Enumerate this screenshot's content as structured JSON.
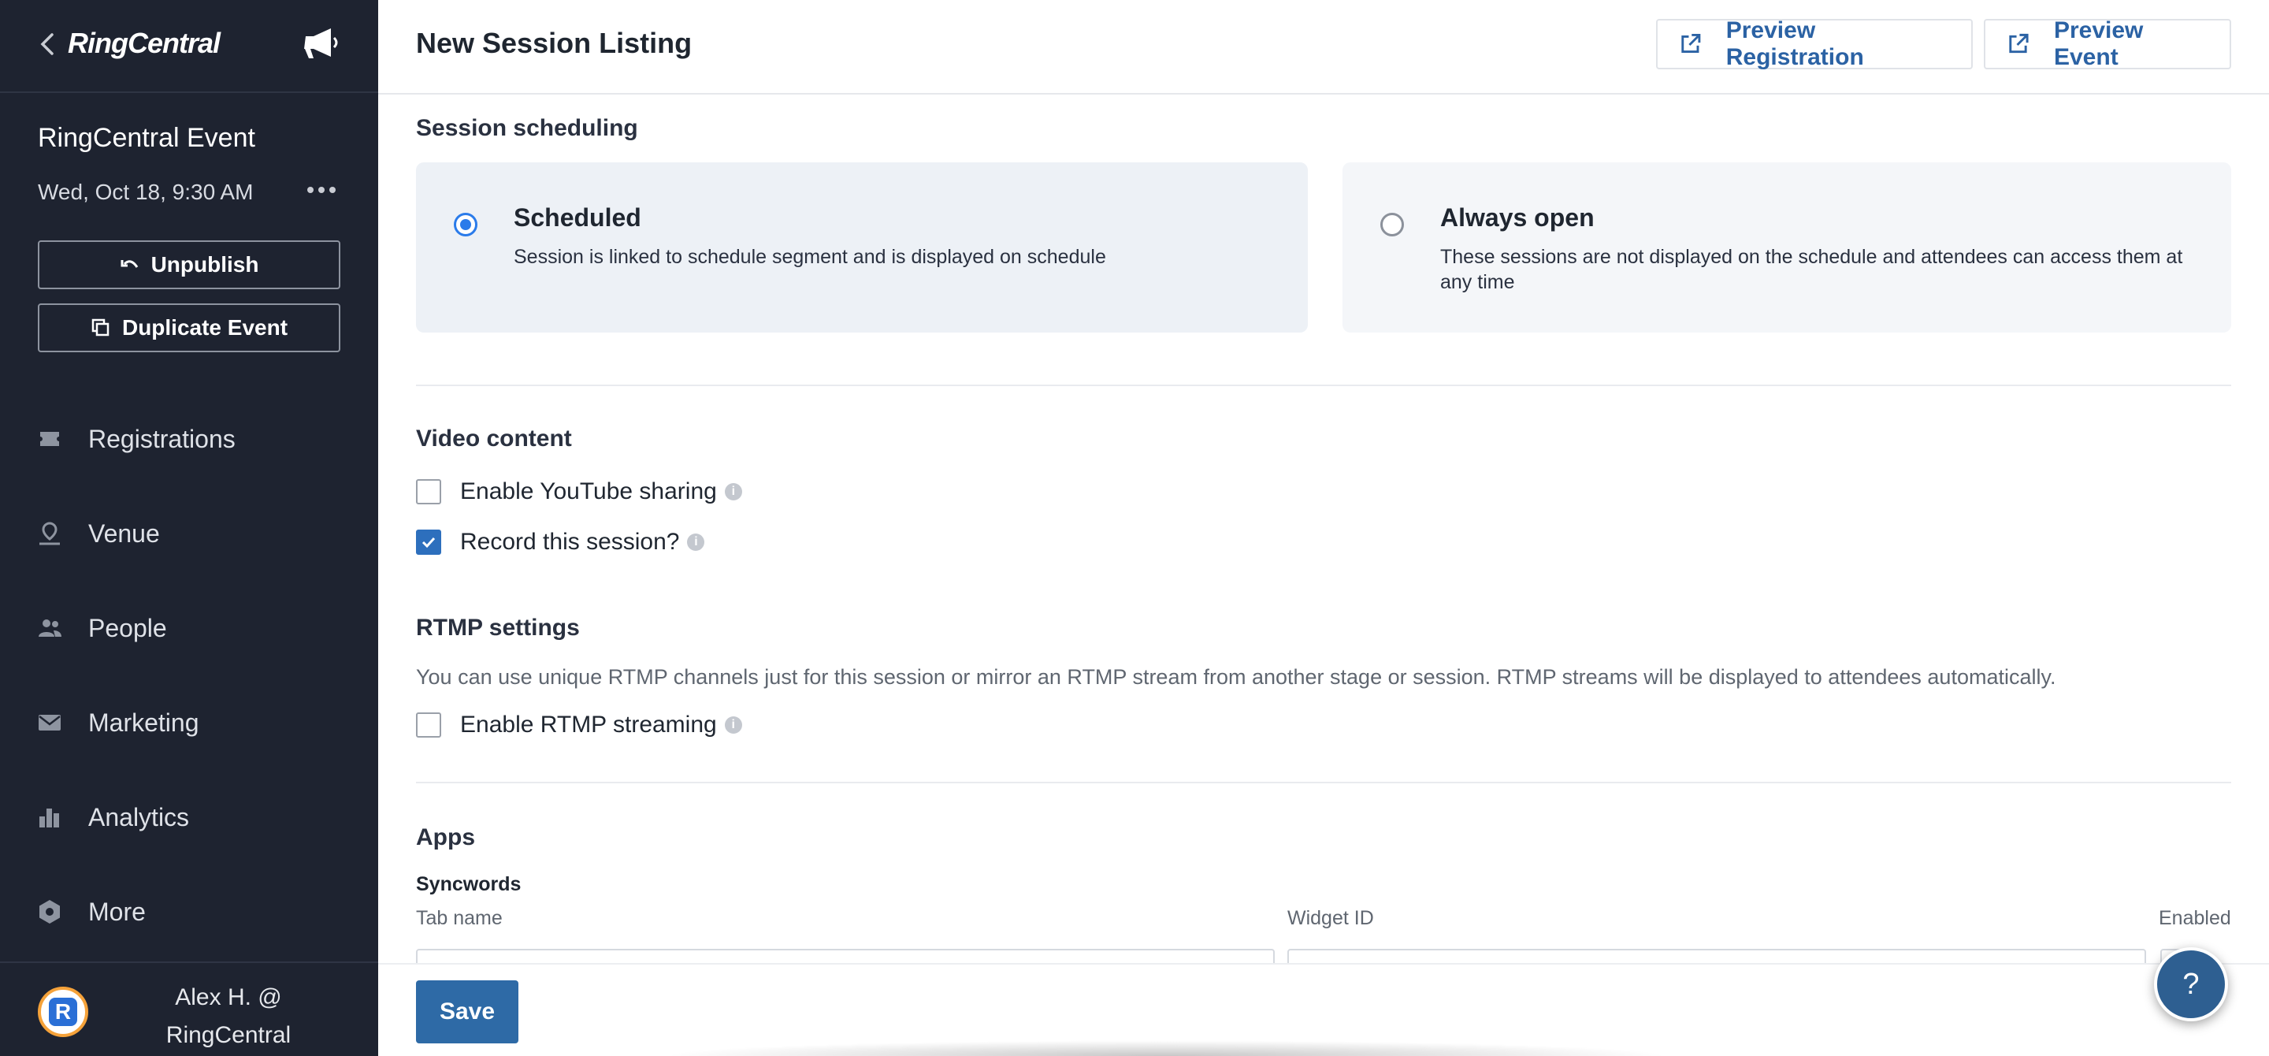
{
  "sidebar": {
    "brand": "RingCentral",
    "event_title": "RingCentral Event",
    "event_date": "Wed, Oct 18, 9:30 AM",
    "unpublish_label": "Unpublish",
    "duplicate_label": "Duplicate Event",
    "nav": [
      {
        "label": "Registrations",
        "icon": "ticket-icon"
      },
      {
        "label": "Venue",
        "icon": "venue-icon"
      },
      {
        "label": "People",
        "icon": "people-icon"
      },
      {
        "label": "Marketing",
        "icon": "mail-icon"
      },
      {
        "label": "Analytics",
        "icon": "bar-chart-icon"
      },
      {
        "label": "More",
        "icon": "gear-icon"
      }
    ],
    "user_line1": "Alex H. @",
    "user_line2": "RingCentral"
  },
  "header": {
    "title": "New Session Listing",
    "preview_registration": "Preview Registration",
    "preview_event": "Preview Event"
  },
  "scheduling": {
    "title": "Session scheduling",
    "options": [
      {
        "title": "Scheduled",
        "desc": "Session is linked to schedule segment and is displayed on schedule",
        "selected": true
      },
      {
        "title": "Always open",
        "desc": "These sessions are not displayed on the schedule and attendees can access them at any time",
        "selected": false
      }
    ]
  },
  "video": {
    "title": "Video content",
    "youtube_label": "Enable YouTube sharing",
    "youtube_checked": false,
    "record_label": "Record this session?",
    "record_checked": true
  },
  "rtmp": {
    "title": "RTMP settings",
    "help": "You can use unique RTMP channels just for this session or mirror an RTMP stream from another stage or session. RTMP streams will be displayed to attendees automatically.",
    "enable_label": "Enable RTMP streaming",
    "enable_checked": false
  },
  "apps": {
    "title": "Apps",
    "app_name": "Syncwords",
    "tab_name_label": "Tab name",
    "widget_id_label": "Widget ID",
    "enabled_label": "Enabled",
    "tab_name_value": "",
    "widget_id_value": ""
  },
  "footer": {
    "save_label": "Save",
    "help_label": "?"
  },
  "colors": {
    "sidebar_bg": "#1e2330",
    "accent_blue": "#2e6aa6",
    "link_blue": "#2b62a4",
    "radio_blue": "#2a7bea"
  }
}
